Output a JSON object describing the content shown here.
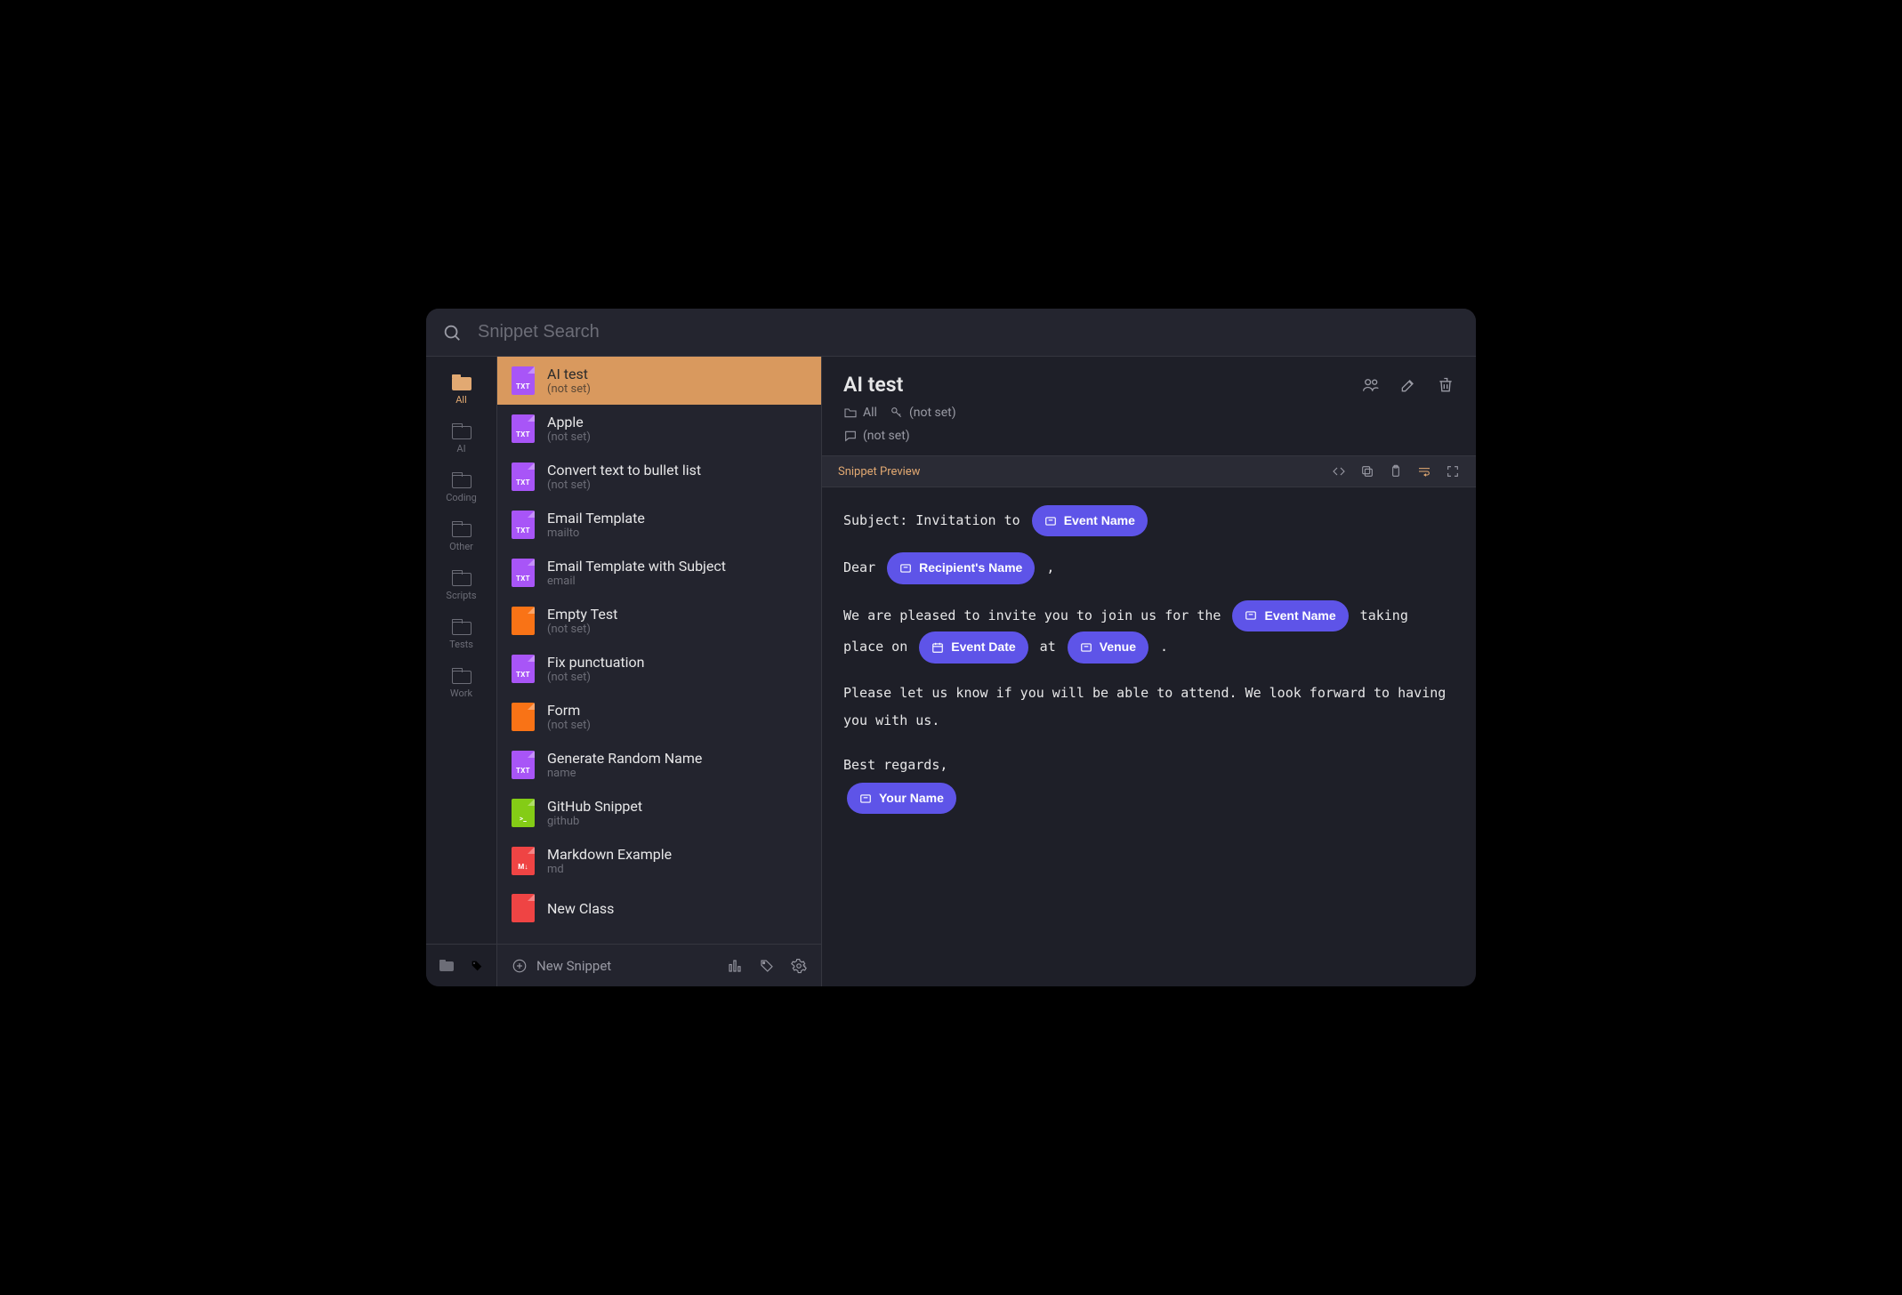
{
  "search": {
    "placeholder": "Snippet Search"
  },
  "sidebar": {
    "items": [
      {
        "label": "All",
        "active": true
      },
      {
        "label": "AI",
        "active": false
      },
      {
        "label": "Coding",
        "active": false
      },
      {
        "label": "Other",
        "active": false
      },
      {
        "label": "Scripts",
        "active": false
      },
      {
        "label": "Tests",
        "active": false
      },
      {
        "label": "Work",
        "active": false
      }
    ]
  },
  "list": {
    "items": [
      {
        "title": "AI test",
        "sub": "(not set)",
        "color": "purple",
        "glyph": "TXT",
        "selected": true
      },
      {
        "title": "Apple",
        "sub": "(not set)",
        "color": "purple",
        "glyph": "TXT",
        "selected": false
      },
      {
        "title": "Convert text to bullet list",
        "sub": "(not set)",
        "color": "purple",
        "glyph": "TXT",
        "selected": false
      },
      {
        "title": "Email Template",
        "sub": "mailto",
        "color": "purple",
        "glyph": "TXT",
        "selected": false
      },
      {
        "title": "Email Template with Subject",
        "sub": "email",
        "color": "purple",
        "glyph": "TXT",
        "selected": false
      },
      {
        "title": "Empty Test",
        "sub": "(not set)",
        "color": "orange",
        "glyph": "",
        "selected": false
      },
      {
        "title": "Fix punctuation",
        "sub": "(not set)",
        "color": "purple",
        "glyph": "TXT",
        "selected": false
      },
      {
        "title": "Form",
        "sub": "(not set)",
        "color": "orange",
        "glyph": "",
        "selected": false
      },
      {
        "title": "Generate Random Name",
        "sub": "name",
        "color": "purple",
        "glyph": "TXT",
        "selected": false
      },
      {
        "title": "GitHub Snippet",
        "sub": "github",
        "color": "green",
        "glyph": ">_",
        "selected": false
      },
      {
        "title": "Markdown Example",
        "sub": "md",
        "color": "red",
        "glyph": "M↓",
        "selected": false
      },
      {
        "title": "New Class",
        "sub": "",
        "color": "red",
        "glyph": "",
        "selected": false
      }
    ],
    "footer": {
      "new": "New Snippet"
    }
  },
  "detail": {
    "title": "AI test",
    "meta": {
      "folder": "All",
      "keyword": "(not set)",
      "note": "(not set)"
    },
    "preview_label": "Snippet Preview",
    "body": {
      "line1_pre": "Subject: Invitation to ",
      "pill_event1": "Event Name",
      "line2_pre": "Dear ",
      "pill_recipient": "Recipient's Name",
      "line2_post": ",",
      "line3_pre": "We are pleased to invite you to join us for the ",
      "pill_event2": "Event Name",
      "line3_mid1": " taking place on ",
      "pill_date": "Event Date",
      "line3_mid2": " at ",
      "pill_venue": "Venue",
      "line3_post": ".",
      "line4": "Please let us know if you will be able to attend. We look forward to having you with us.",
      "line5": "Best regards,",
      "pill_your": "Your Name"
    }
  }
}
